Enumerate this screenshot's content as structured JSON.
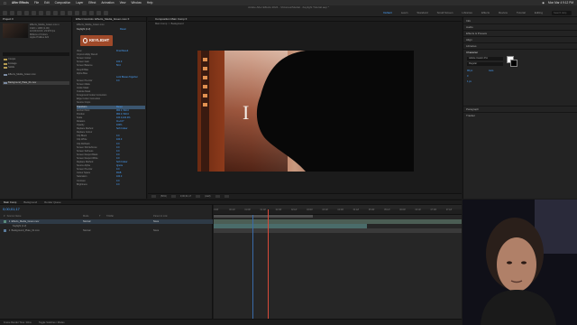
{
  "menubar": {
    "app_name": "After Effects",
    "items": [
      "File",
      "Edit",
      "Composition",
      "Layer",
      "Effect",
      "Animation",
      "View",
      "Window",
      "Help"
    ],
    "clock": "Mon Mar 4  9:12 PM"
  },
  "window": {
    "title": "Adobe After Effects 2024 - /Volumes/Media/...Keylight Tutorial.aep *"
  },
  "toolbar": {
    "workspaces": [
      "Default",
      "Learn",
      "Standard",
      "Small Screen",
      "Libraries",
      "Effects",
      "Review",
      "Tutorial",
      "Editing"
    ],
    "active_workspace": "Default",
    "search_placeholder": "Search Help"
  },
  "project_panel": {
    "title": "Project ≡",
    "meta": [
      "Effects_Media_Green.mov ▾",
      "1920 x 1080 (1.00)",
      "Δ 0;00;10;00, 23.976 fps",
      "Millions of Colors",
      "Apple ProRes 422"
    ],
    "items": [
      {
        "label": "Comps",
        "type": "folder"
      },
      {
        "label": "Footage",
        "type": "folder"
      },
      {
        "label": "Solids",
        "type": "folder"
      },
      {
        "label": "Effects_Media_Green.mov",
        "type": "footage"
      },
      {
        "label": "Background_Plate_01.mov",
        "type": "footage"
      }
    ],
    "selected_index": 4
  },
  "effect_controls": {
    "title": "Effect Controls: Effects_Media_Green.mov ≡",
    "layer": "Effects_Media_Green.mov",
    "effect": "Keylight (1.2)",
    "logo_text": "KEYLIGHT",
    "reset_label": "Reset",
    "rows": [
      {
        "label": "View",
        "value": "Final Result"
      },
      {
        "label": "Unpremultiply Result",
        "value": ""
      },
      {
        "label": "Screen Colour",
        "value": ""
      },
      {
        "label": "Screen Gain",
        "value": "100.0"
      },
      {
        "label": "Screen Balance",
        "value": "50.0"
      },
      {
        "label": "Despill Bias",
        "value": ""
      },
      {
        "label": "Alpha Bias",
        "value": ""
      },
      {
        "label": "",
        "value": "Lock Biases Together"
      },
      {
        "label": "Screen Pre-blur",
        "value": "0.0"
      },
      {
        "label": "Screen Matte",
        "value": ""
      },
      {
        "label": "Inside Mask",
        "value": ""
      },
      {
        "label": "Outside Mask",
        "value": ""
      },
      {
        "label": "Foreground Colour Correction",
        "value": ""
      },
      {
        "label": "Edge Colour Correction",
        "value": ""
      },
      {
        "label": "Source Crops",
        "value": ""
      },
      {
        "label": "Transform",
        "value": "Reset"
      },
      {
        "label": "Anchor Point",
        "value": "960.0, 540.0"
      },
      {
        "label": "Position",
        "value": "960.0, 540.0"
      },
      {
        "label": "Scale",
        "value": "100.0,100.0%"
      },
      {
        "label": "Rotation",
        "value": "0x+0.0°"
      },
      {
        "label": "Opacity",
        "value": "100%"
      },
      {
        "label": "Replace Method",
        "value": "Soft Colour"
      },
      {
        "label": "Replace Colour",
        "value": ""
      },
      {
        "label": "Clip Black",
        "value": "0.0"
      },
      {
        "label": "Clip White",
        "value": "100.0"
      },
      {
        "label": "Clip Rollback",
        "value": "0.0"
      },
      {
        "label": "Screen Shrink/Grow",
        "value": "0.0"
      },
      {
        "label": "Screen Softness",
        "value": "0.0"
      },
      {
        "label": "Screen Despot Black",
        "value": "0.0"
      },
      {
        "label": "Screen Despot White",
        "value": "0.0"
      },
      {
        "label": "Replace Method",
        "value": "Soft Colour"
      },
      {
        "label": "Source Alpha",
        "value": "Ignore"
      },
      {
        "label": "Screen Pre-blur",
        "value": "0.0"
      },
      {
        "label": "Colour Space",
        "value": "RGB"
      },
      {
        "label": "Saturation",
        "value": "100.0"
      },
      {
        "label": "Contrast",
        "value": "0.0"
      },
      {
        "label": "Brightness",
        "value": "0.0"
      }
    ],
    "selected_row": 15
  },
  "composition": {
    "tab_label": "Composition  Main Comp ≡",
    "sub_tabs": [
      "Main Comp",
      "Background"
    ],
    "zoom": "(50%)",
    "timecode": "0;00;01;17",
    "resolution": "(Half)"
  },
  "right_panel": {
    "sections": [
      "Info",
      "Audio",
      "Effects & Presets",
      "Align",
      "Libraries",
      "Character",
      "Paragraph",
      "Tracker"
    ],
    "character_font": "Adobe Caslon Pro",
    "character_style": "Regular",
    "font_size": "96 px",
    "leading": "Auto",
    "tracking": "0",
    "stroke": "1 px"
  },
  "panel_tabs": [
    "Main Comp",
    "Background",
    "Render Queue"
  ],
  "active_panel_tab": "Main Comp",
  "timeline": {
    "timecode": "0;00;01;17",
    "columns": [
      "#",
      "Source Name",
      "Mode",
      "T",
      "TrkMat",
      "Parent & Link"
    ],
    "layers": [
      {
        "num": "1",
        "name": "Effects_Media_Green.mov",
        "mode": "Normal",
        "parent": "None",
        "color": "#5a8a7a"
      },
      {
        "num": "2",
        "name": "Background_Plate_01.mov",
        "mode": "Normal",
        "parent": "None",
        "color": "#5a7a9a"
      }
    ],
    "property_row": "Keylight (1.2)",
    "ruler_ticks": [
      "0:00f",
      "00:12f",
      "01:00f",
      "01:12f",
      "02:00f",
      "02:12f",
      "03:00f",
      "03:12f",
      "04:00f",
      "04:12f",
      "05:00f",
      "05:12f",
      "06:00f",
      "06:12f",
      "07:00f",
      "07:12f"
    ],
    "current_time_percent": 21.8,
    "work_area_end_percent": 40
  },
  "status": {
    "frame_render": "Frame Render Time: 33ms",
    "toggle": "Toggle Switches / Modes"
  }
}
